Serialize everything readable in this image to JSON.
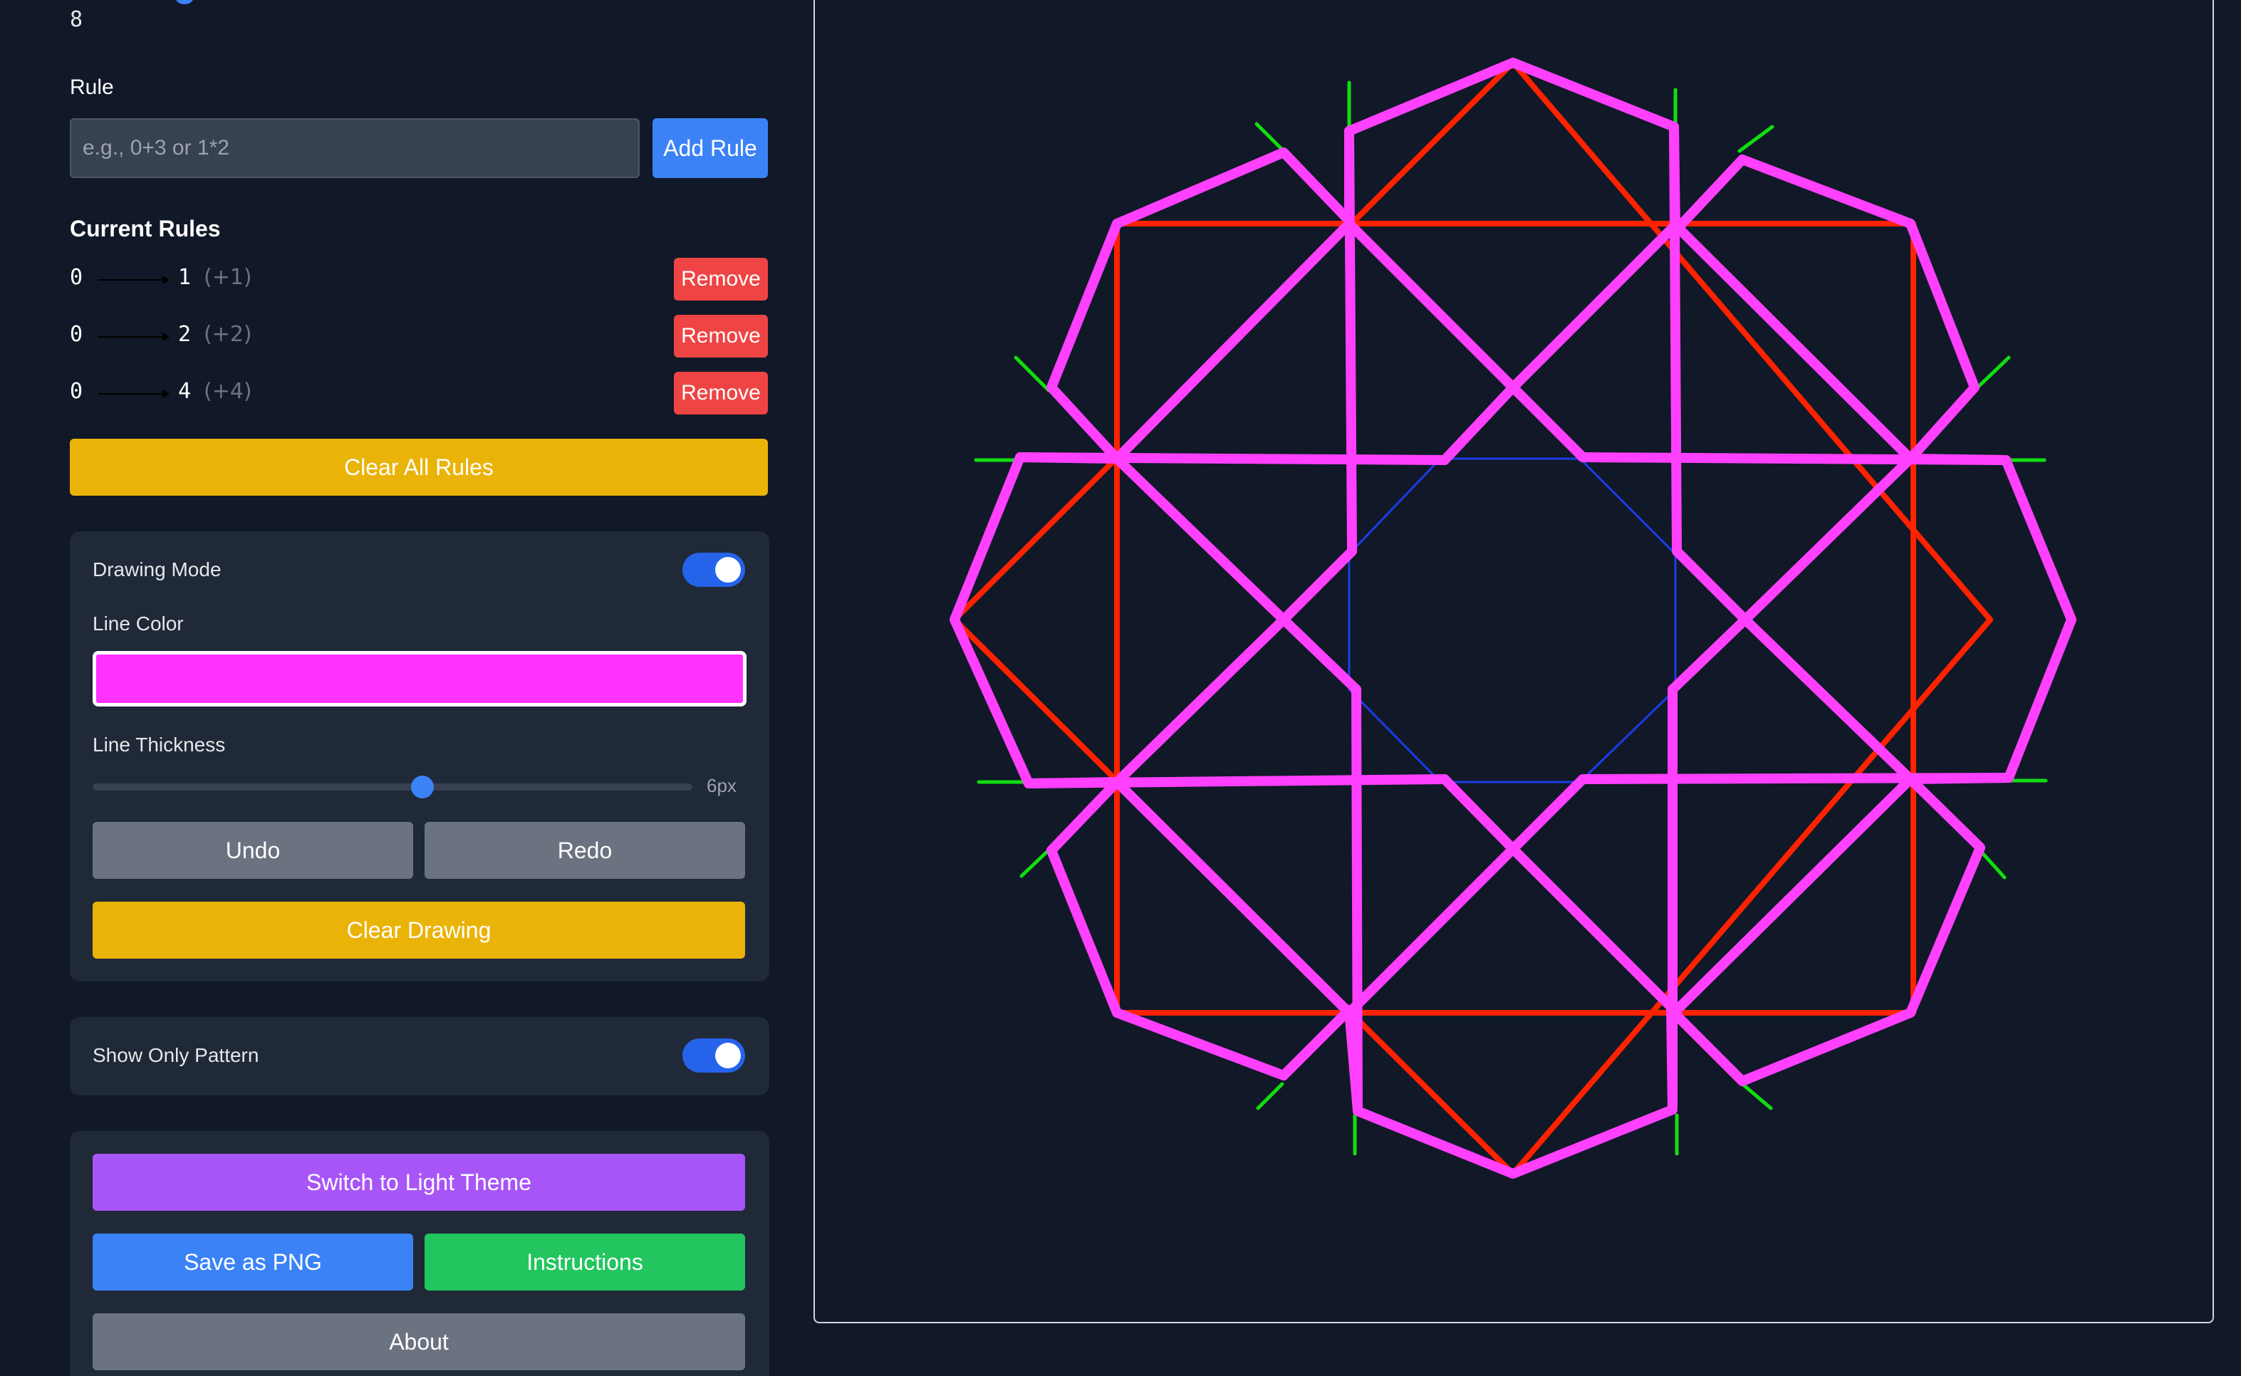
{
  "polygon": {
    "sides_value": "8"
  },
  "rule_form": {
    "label": "Rule",
    "placeholder": "e.g., 0+3 or 1*2",
    "value": "",
    "add_button": "Add Rule"
  },
  "current_rules": {
    "title": "Current Rules",
    "remove_label": "Remove",
    "items": [
      {
        "from": "0",
        "to": "1",
        "delta": "(+1)"
      },
      {
        "from": "0",
        "to": "2",
        "delta": "(+2)"
      },
      {
        "from": "0",
        "to": "4",
        "delta": "(+4)"
      }
    ],
    "clear_all_button": "Clear All Rules"
  },
  "drawing": {
    "mode_label": "Drawing Mode",
    "mode_on": true,
    "line_color_label": "Line Color",
    "line_color": "#ff33ff",
    "thickness_label": "Line Thickness",
    "thickness_value": "6px",
    "thickness_fraction": 0.55,
    "undo_button": "Undo",
    "redo_button": "Redo",
    "clear_button": "Clear Drawing"
  },
  "pattern": {
    "show_only_label": "Show Only Pattern",
    "show_only_on": true
  },
  "actions": {
    "theme_button": "Switch to Light Theme",
    "save_button": "Save as PNG",
    "instructions_button": "Instructions",
    "about_button": "About"
  },
  "colors": {
    "background": "#111827",
    "panel": "#1f2937",
    "accent_blue": "#3b82f6",
    "remove_red": "#ef4444",
    "yellow": "#eab308",
    "gray": "#6b7280",
    "purple": "#a855f7",
    "green": "#22c55e",
    "pattern_red": "#ff2200",
    "pattern_blue": "#1a3ee8",
    "pattern_green": "#11dd11",
    "drawing_magenta": "#ff40ff"
  },
  "icons": {
    "rule_arrow": "long-right-arrow-icon"
  }
}
